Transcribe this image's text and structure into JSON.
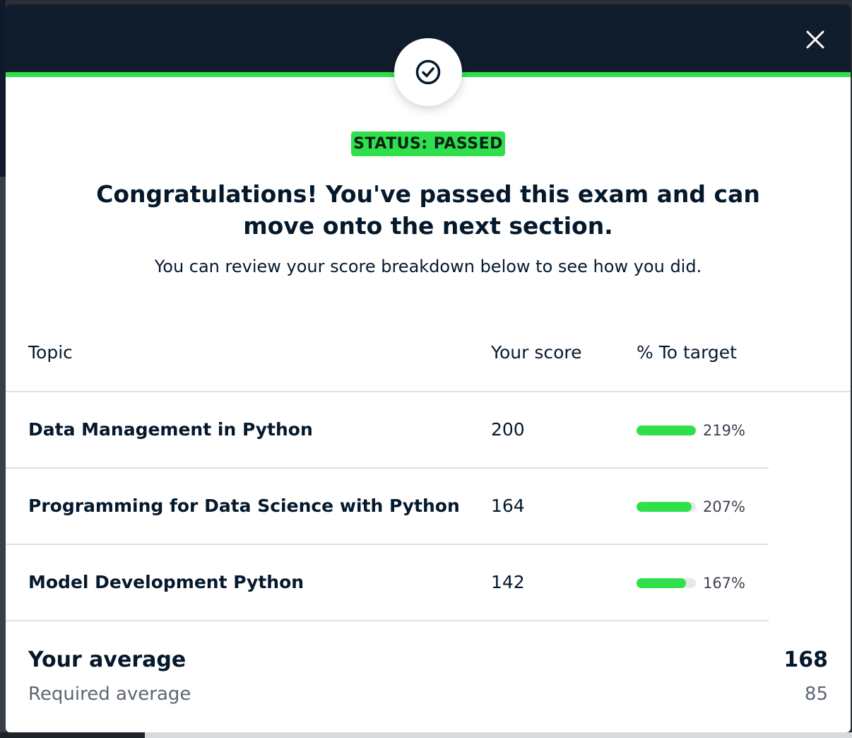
{
  "modal": {
    "status_badge": "STATUS: PASSED",
    "headline": "Congratulations! You've passed this exam and can move onto the next section.",
    "subline": "You can review your score breakdown below to see how you did.",
    "close_icon": "close-icon",
    "status_icon": "check-circle-icon"
  },
  "table": {
    "headers": [
      "Topic",
      "Your score",
      "% To target"
    ],
    "rows": [
      {
        "topic": "Data Management in Python",
        "score": "200",
        "pct": "219%",
        "fill": 1.0
      },
      {
        "topic": "Programming for Data Science with Python",
        "score": "164",
        "pct": "207%",
        "fill": 0.93
      },
      {
        "topic": "Model Development Python",
        "score": "142",
        "pct": "167%",
        "fill": 0.83
      }
    ]
  },
  "summary": {
    "average_label": "Your average",
    "average_value": "168",
    "required_label": "Required average",
    "required_value": "85"
  },
  "colors": {
    "header_bg": "#101d2d",
    "accent_green": "#2fe04c",
    "text_dark": "#05192d",
    "text_muted": "#5d6576"
  }
}
